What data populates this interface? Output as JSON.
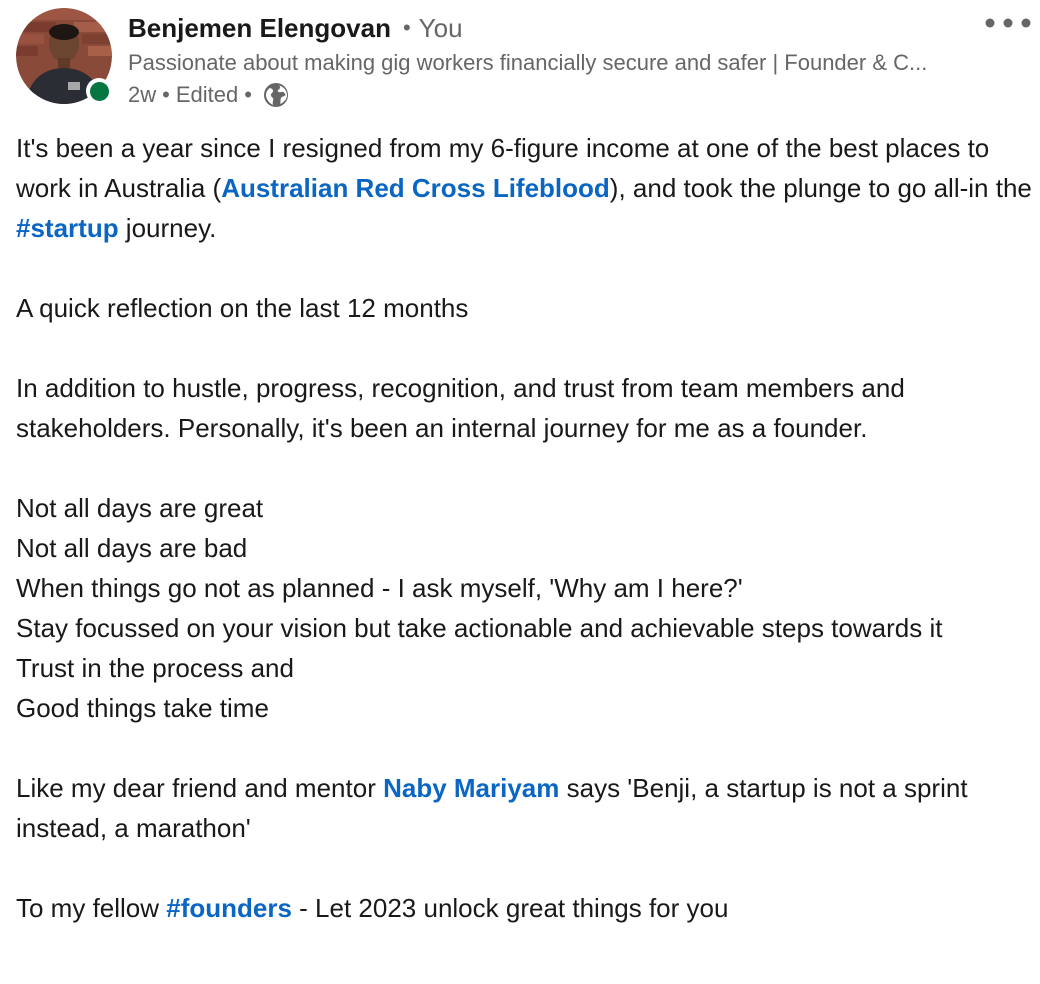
{
  "author": {
    "name": "Benjemen Elengovan",
    "relation": "You",
    "headline": "Passionate about making gig workers financially secure and safer | Founder & C...",
    "age": "2w",
    "edited": "Edited",
    "visibility_icon": "globe-icon",
    "presence_color": "#057642",
    "avatar_icon": "profile-photo"
  },
  "menu": {
    "more_icon": "ellipsis-icon"
  },
  "post": {
    "p1": {
      "before_mention": "It's been a year since I resigned from my 6-figure income at one of the best places to work in Australia (",
      "mention": "Australian Red Cross Lifeblood",
      "after_mention": "), and took the plunge to go all-in the ",
      "hashtag": "#startup",
      "after_hashtag": " journey."
    },
    "p2": "A quick reflection on the last 12 months",
    "p3": "In addition to hustle, progress, recognition, and trust from team members and stakeholders. Personally, it's been an internal journey for me as a founder.",
    "lines": [
      "Not all days are great",
      "Not all days are bad",
      "When things go not as planned - I ask myself, 'Why am I here?'",
      "Stay focussed on your vision but take actionable and achievable steps towards it",
      "Trust in the process and",
      "Good things take time"
    ],
    "p5": {
      "before_mention": "Like my dear friend and mentor ",
      "mention": "Naby Mariyam",
      "after_mention": " says 'Benji, a startup is not a sprint instead, a marathon'"
    },
    "p6": {
      "before_hashtag": "To my fellow ",
      "hashtag": "#founders",
      "after_hashtag": " - Let 2023 unlock great things for you"
    }
  },
  "colors": {
    "link": "#0a66c2",
    "text": "#191919",
    "secondary": "#666666"
  }
}
